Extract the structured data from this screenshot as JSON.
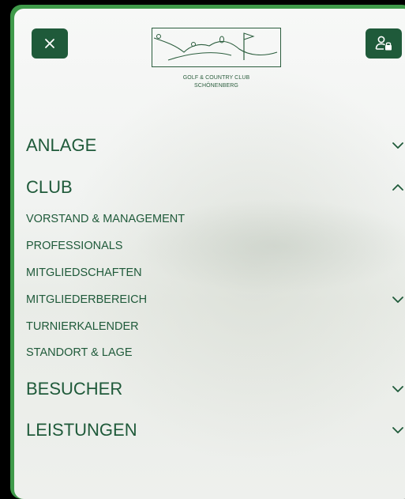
{
  "logo": {
    "line1": "GOLF & COUNTRY CLUB",
    "line2": "SCHÖNENBERG"
  },
  "header": {
    "close_icon": "close-icon",
    "login_icon": "user-lock-icon"
  },
  "menu": {
    "anlage": "ANLAGE",
    "club": "CLUB",
    "club_sub": {
      "vorstand": "VORSTAND & MANAGEMENT",
      "professionals": "PROFESSIONALS",
      "mitgliedschaften": "MITGLIEDSCHAFTEN",
      "mitgliederbereich": "MITGLIEDERBEREICH",
      "turnierkalender": "TURNIERKALENDER",
      "standort": "STANDORT & LAGE"
    },
    "besucher": "BESUCHER",
    "leistungen": "LEISTUNGEN"
  },
  "colors": {
    "accent": "#1f5a3a",
    "frame": "#3f9a4a",
    "background": "#f3f5f3"
  }
}
